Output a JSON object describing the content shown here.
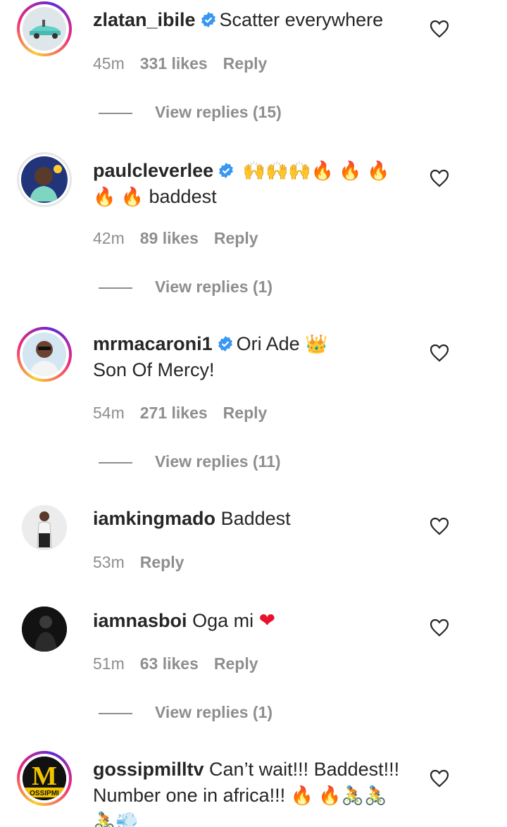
{
  "colors": {
    "text": "#262626",
    "meta": "#8e8e8e",
    "verified": "#3897f0",
    "heart_red": "#e8112d",
    "fire": "#f77f00"
  },
  "comments": [
    {
      "username": "zlatan_ibile",
      "verified": true,
      "text": "Scatter everywhere",
      "time": "45m",
      "likes": "331 likes",
      "reply": "Reply",
      "view_replies": "View replies (15)",
      "avatar_icon": "car-photo"
    },
    {
      "username": "paulcleverlee",
      "verified": true,
      "text": "baddest",
      "time": "42m",
      "likes": "89 likes",
      "reply": "Reply",
      "view_replies": "View replies (1)",
      "avatar_icon": "person-photo",
      "emojis_line1": [
        "raised-hands-emoji",
        "raised-hands-emoji",
        "raised-hands-emoji",
        "fire-emoji",
        "fire-emoji",
        "fire-emoji"
      ],
      "emojis_line2": [
        "fire-emoji",
        "fire-emoji"
      ]
    },
    {
      "username": "mrmacaroni1",
      "verified": true,
      "text": "Ori Ade",
      "text_line2": "Son Of Mercy!",
      "time": "54m",
      "likes": "271 likes",
      "reply": "Reply",
      "view_replies": "View replies (11)",
      "avatar_icon": "person-photo",
      "emoji": "crown-emoji"
    },
    {
      "username": "iamkingmado",
      "verified": false,
      "text": "Baddest",
      "time": "53m",
      "reply": "Reply",
      "avatar_icon": "person-photo"
    },
    {
      "username": "iamnasboi",
      "verified": false,
      "text": "Oga mi",
      "time": "51m",
      "likes": "63 likes",
      "reply": "Reply",
      "view_replies": "View replies (1)",
      "avatar_icon": "person-photo",
      "emoji": "red-heart-emoji"
    },
    {
      "username": "gossipmilltv",
      "verified": false,
      "text": "Can’t wait!!! Baddest!!!",
      "text_line2": "Number one in africa!!!",
      "time": "",
      "avatar_icon": "logo-m",
      "avatar_letter": "M",
      "avatar_sub": "OSSIPMI",
      "emojis_line2": [
        "fire-emoji",
        "fire-emoji",
        "cyclist-emoji",
        "cyclist-emoji"
      ],
      "emojis_line3": [
        "cyclist-emoji",
        "dash-emoji"
      ]
    }
  ]
}
